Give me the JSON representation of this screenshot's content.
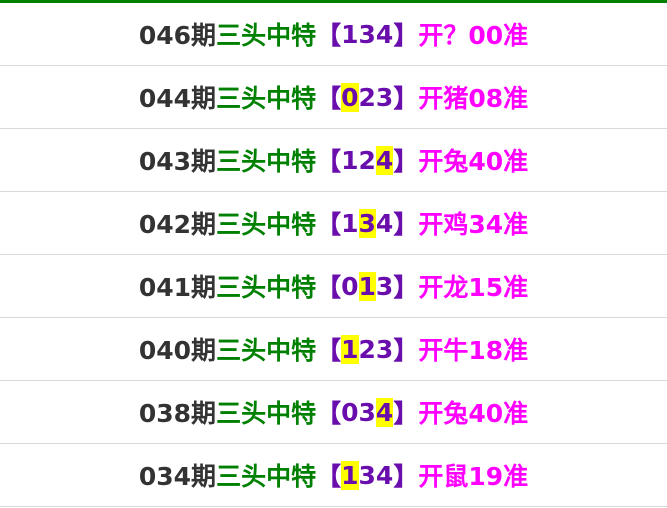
{
  "colors": {
    "top_border": "#008000",
    "period_text": "#333333",
    "label_text": "#008000",
    "number_text": "#6a0dad",
    "result_text": "#ff00ff",
    "highlight": "#ffff00",
    "divider": "#d9d9d9"
  },
  "rows": [
    {
      "period": "046期",
      "label": "三头中特",
      "open_bracket": "【",
      "digits": [
        "1",
        "3",
        "4"
      ],
      "highlight": -1,
      "close_bracket": "】",
      "result": "开？00准"
    },
    {
      "period": "044期",
      "label": "三头中特",
      "open_bracket": "【",
      "digits": [
        "0",
        "2",
        "3"
      ],
      "highlight": 0,
      "close_bracket": "】",
      "result": "开猪08准"
    },
    {
      "period": "043期",
      "label": "三头中特",
      "open_bracket": "【",
      "digits": [
        "1",
        "2",
        "4"
      ],
      "highlight": 2,
      "close_bracket": "】",
      "result": "开兔40准"
    },
    {
      "period": "042期",
      "label": "三头中特",
      "open_bracket": "【",
      "digits": [
        "1",
        "3",
        "4"
      ],
      "highlight": 1,
      "close_bracket": "】",
      "result": "开鸡34准"
    },
    {
      "period": "041期",
      "label": "三头中特",
      "open_bracket": "【",
      "digits": [
        "0",
        "1",
        "3"
      ],
      "highlight": 1,
      "close_bracket": "】",
      "result": "开龙15准"
    },
    {
      "period": "040期",
      "label": "三头中特",
      "open_bracket": "【",
      "digits": [
        "1",
        "2",
        "3"
      ],
      "highlight": 0,
      "close_bracket": "】",
      "result": "开牛18准"
    },
    {
      "period": "038期",
      "label": "三头中特",
      "open_bracket": "【",
      "digits": [
        "0",
        "3",
        "4"
      ],
      "highlight": 2,
      "close_bracket": "】",
      "result": "开兔40准"
    },
    {
      "period": "034期",
      "label": "三头中特",
      "open_bracket": "【",
      "digits": [
        "1",
        "3",
        "4"
      ],
      "highlight": 0,
      "close_bracket": "】",
      "result": "开鼠19准"
    }
  ]
}
